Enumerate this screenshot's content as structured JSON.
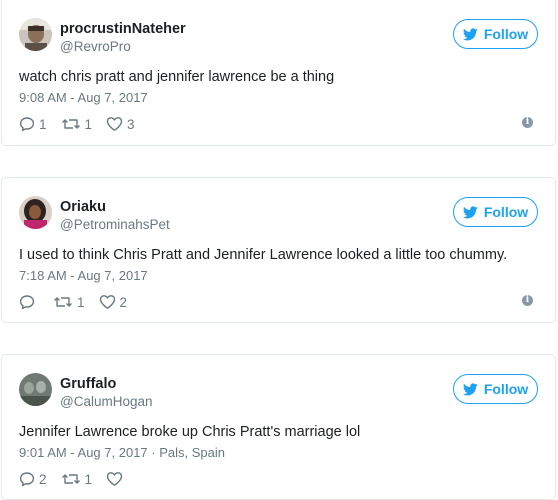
{
  "colors": {
    "accent": "#1da1f2",
    "text": "#1c2022",
    "muted": "#697882",
    "border": "#e1e8ed"
  },
  "tweets": [
    {
      "name": "procrustinNateher",
      "handle": "@RevroPro",
      "follow_label": "Follow",
      "text": "watch chris pratt and jennifer lawrence be a thing",
      "meta": "9:08 AM - Aug 7, 2017",
      "reply_count": "1",
      "retweet_count": "1",
      "like_count": "3",
      "avatar_icon": "avatar-icon"
    },
    {
      "name": "Oriaku",
      "handle": "@PetrominahsPet",
      "follow_label": "Follow",
      "text": "I used to think Chris Pratt and Jennifer Lawrence looked a little too chummy.",
      "meta": "7:18 AM - Aug 7, 2017",
      "reply_count": "",
      "retweet_count": "1",
      "like_count": "2",
      "avatar_icon": "avatar-icon"
    },
    {
      "name": "Gruffalo",
      "handle": "@CalumHogan",
      "follow_label": "Follow",
      "text": "Jennifer Lawrence broke up Chris Pratt's marriage lol",
      "meta": "9:01 AM - Aug 7, 2017 · Pals, Spain",
      "reply_count": "2",
      "retweet_count": "1",
      "like_count": "",
      "avatar_icon": "avatar-icon"
    }
  ]
}
